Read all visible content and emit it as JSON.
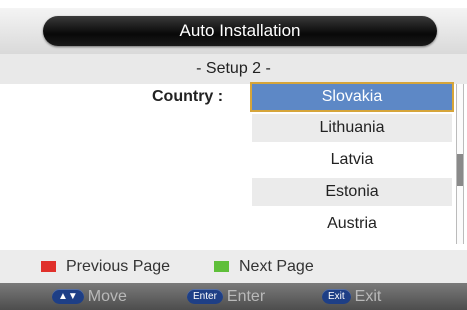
{
  "title": "Auto Installation",
  "subtitle": "- Setup 2 -",
  "country_label": "Country :",
  "countries": [
    "Slovakia",
    "Lithuania",
    "Latvia",
    "Estonia",
    "Austria"
  ],
  "selected_index": 0,
  "keys": {
    "previous_label": "Previous Page",
    "previous_color": "#e0302b",
    "next_label": "Next Page",
    "next_color": "#5fbf3a"
  },
  "help": {
    "move_key": "▲▼",
    "move_label": "Move",
    "enter_key": "Enter",
    "enter_label": "Enter",
    "exit_key": "Exit",
    "exit_label": "Exit"
  }
}
